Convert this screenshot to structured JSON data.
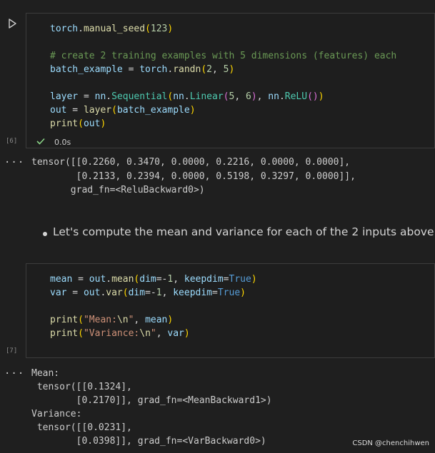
{
  "cell1": {
    "exec_count": "[6]",
    "status_time": "0.0s",
    "code": {
      "l1": "torch.manual_seed(123)",
      "l2": "# create 2 training examples with 5 dimensions (features) each",
      "l3": "batch_example = torch.randn(2, 5)",
      "l4": "layer = nn.Sequential(nn.Linear(5, 6), nn.ReLU())",
      "l5": "out = layer(batch_example)",
      "l6": "print(out)"
    },
    "output": [
      "tensor([[0.2260, 0.3470, 0.0000, 0.2216, 0.0000, 0.0000],",
      "        [0.2133, 0.2394, 0.0000, 0.5198, 0.3297, 0.0000]],",
      "       grad_fn=<ReluBackward0>)"
    ]
  },
  "markdown": {
    "bullet_text": "Let's compute the mean and variance for each of the 2 inputs above:"
  },
  "cell2": {
    "exec_count": "[7]",
    "code": {
      "l1": "mean = out.mean(dim=-1, keepdim=True)",
      "l2": "var = out.var(dim=-1, keepdim=True)",
      "l3": "print(\"Mean:\\n\", mean)",
      "l4": "print(\"Variance:\\n\", var)"
    },
    "output": [
      "Mean:",
      " tensor([[0.1324],",
      "        [0.2170]], grad_fn=<MeanBackward1>)",
      "Variance:",
      " tensor([[0.0231],",
      "        [0.0398]], grad_fn=<VarBackward0>)"
    ]
  },
  "ui": {
    "output_menu": "...",
    "watermark": "CSDN @chenchihwen"
  },
  "colors": {
    "background": "#1f1f1f",
    "cell_border": "#3c3c3c",
    "success_check": "#89d185"
  }
}
